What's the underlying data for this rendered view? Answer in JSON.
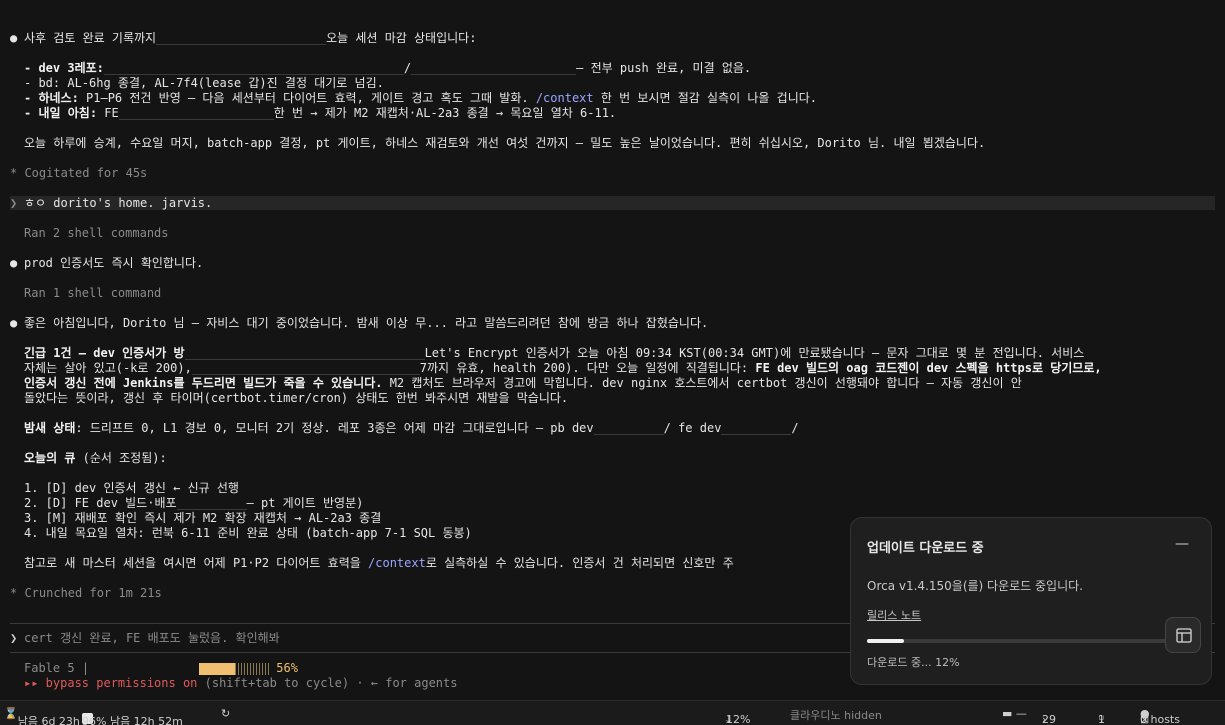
{
  "terminal": {
    "l1": "사후 검토 완료 기록까지",
    "l1b": "오늘 세션 마감 상태입니다:",
    "l2a": "- dev 3레포:",
    "l2b": "/",
    "l2c": "— 전부 push 완료, 미결 없음.",
    "l3": "- bd: AL-6hg 종결, AL-7f4(lease 갑)진 결정 대기로 넘김.",
    "l4a": "- 하네스:",
    "l4b": " P1–P6 전건 반영 — 다음 세션부터 다이어트 효력, 게이트 경고 혹도 그때 발화. ",
    "l4c": "/context",
    "l4d": " 한 번 보시면 절감 실측이 나올 겁니다.",
    "l5a": "- 내일 아침:",
    "l5b": " FE",
    "l5c": "한 번 → 제가 M2 재캡처·AL-2a3 종결 → 목요일 열차 6-11.",
    "l6": "오늘 하루에 승계, 수요일 머지, batch-app 결정, pt 게이트, 하네스 재검토와 개선 여섯 건까지 — 밀도 높은 날이었습니다. 편히 쉬십시오, Dorito 님. 내일 뵙겠습니다.",
    "l7": "* Cogitated for 45s",
    "l8": "ㅎㅇ dorito's home. jarvis.",
    "l9": "Ran 2 shell commands",
    "l10": "prod 인증서도 즉시 확인합니다.",
    "l11": "Ran 1 shell command",
    "l12": "좋은 아침입니다, Dorito 님 — 자비스 대기 중이었습니다. 밤새 이상 무... 라고 말씀드리려던 참에 방금 하나 잡혔습니다.",
    "l13a": "긴급 1건 — dev 인증서가 방",
    "l13b": "Let's Encrypt 인증서가 오늘 아침 09:34 KST(00:34 GMT)에 만료됐습니다 — 문자 그대로 몇 분 전입니다. 서비스",
    "l14a": "자체는 살아 있고(-k로 200),",
    "l14b": "7까지 유효, health 200). 다만 오늘 일정에 직결됩니다: ",
    "l14c": "FE dev 빌드의 oag 코드젠이 dev 스펙을 https로 당기므로,",
    "l15a": "인증서 갱신 전에 Jenkins를 두드리면 빌드가 죽을 수 있습니다.",
    "l15b": " M2 캡처도 브라우저 경고에 막힙니다. dev nginx 호스트에서 certbot 갱신이 선행돼야 합니다 — 자동 갱신이 안",
    "l16": "돌았다는 뜻이라, 갱신 후 타이머(certbot.timer/cron) 상태도 한번 봐주시면 재발을 막습니다.",
    "l17a": "밤새 상태",
    "l17b": ": 드리프트 0, L1 경보 0, 모니터 2기 정상. 레포 3종은 어제 마감 그대로입니다 — pb dev",
    "l17c": "/ fe dev",
    "l17d": "/",
    "l18a": "오늘의 큐",
    "l18b": " (순서 조정됨):",
    "q1": "1. [D] dev 인증서 갱신 ← 신규 선행",
    "q2a": "2. [D] FE dev 빌드·배포",
    "q2b": "— pt 게이트 반영분)",
    "q3": "3. [M] 재배포 확인 즉시 제가 M2 확장 재캡처 → AL-2a3 종결",
    "q4": "4. 내일 목요일 열차: 런북 6-11 준비 완료 상태 (batch-app 7-1 SQL 동봉)",
    "l19a": "참고로 새 마스터 세션을 여시면 어제 P1·P2 다이어트 효력을 ",
    "l19b": "/context",
    "l19c": "로 실측하실 수 있습니다. 인증서 건 처리되면 신호만 주",
    "l20": "* Crunched for 1m 21s",
    "prompt_sym": "❯",
    "prompt_text": "cert 갱신 완료, FE 배포도 눌렀음. 확인해봐",
    "model": "Fable 5",
    "pipe": "|",
    "ctx_pct": "56%",
    "perm_a": "▸▸ bypass permissions on",
    "perm_b": " (shift+tab to cycle) · ← for agents"
  },
  "status": {
    "left1": "남음 6d 23h",
    "left2": "96% 남음 12h 52m",
    "download": "12%",
    "claude": "클라우디노 hidden",
    "count1": "29",
    "count2": "1",
    "hosts": "0 hosts"
  },
  "toast": {
    "title": "업데이트 다운로드 중",
    "message": "Orca v1.4.150을(를) 다운로드 중입니다.",
    "release_notes": "릴리스 노트",
    "status": "다운로드 중... 12%",
    "progress": 0.12
  }
}
